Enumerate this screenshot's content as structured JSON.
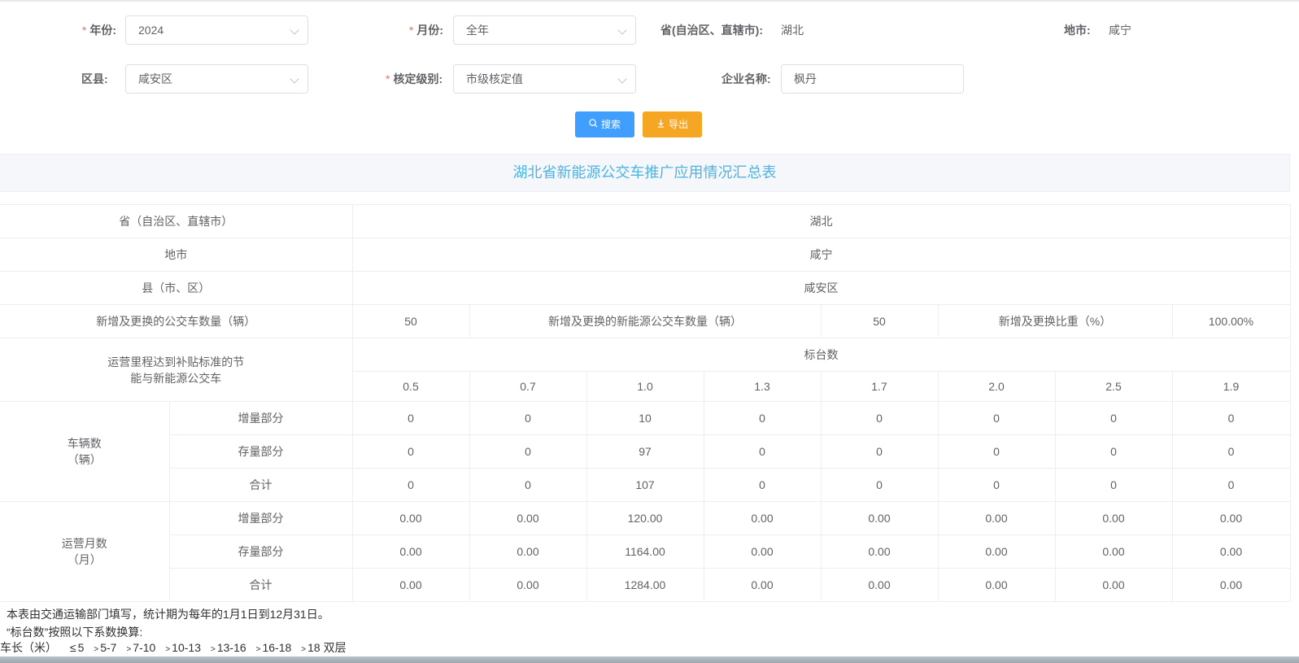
{
  "form": {
    "year": {
      "label": "年份:",
      "value": "2024"
    },
    "month": {
      "label": "月份:",
      "value": "全年"
    },
    "province": {
      "label": "省(自治区、直辖市):",
      "value": "湖北"
    },
    "city": {
      "label": "地市:",
      "value": "咸宁"
    },
    "district": {
      "label": "区县:",
      "value": "咸安区"
    },
    "level": {
      "label": "核定级别:",
      "value": "市级核定值"
    },
    "company": {
      "label": "企业名称:",
      "value": "枫丹"
    },
    "required_mark": "*"
  },
  "buttons": {
    "search": {
      "label": "搜索",
      "icon": "search-icon"
    },
    "export": {
      "label": "导出",
      "icon": "download-icon"
    }
  },
  "report": {
    "title": "湖北省新能源公交车推广应用情况汇总表",
    "province_label": "省（自治区、直辖市）",
    "province_value": "湖北",
    "city_label": "地市",
    "city_value": "咸宁",
    "county_label": "县（市、区）",
    "county_value": "咸安区",
    "new_bus_label": "新增及更换的公交车数量（辆）",
    "new_bus_value": "50",
    "new_ne_bus_label": "新增及更换的新能源公交车数量（辆）",
    "new_ne_bus_value": "50",
    "ratio_label": "新增及更换比重（%）",
    "ratio_value": "100.00%",
    "mileage_label_1": "运营里程达到补贴标准的节",
    "mileage_label_2": "能与新能源公交车",
    "standard_count_label": "标台数",
    "coefficients": [
      "0.5",
      "0.7",
      "1.0",
      "1.3",
      "1.7",
      "2.0",
      "2.5",
      "1.9"
    ],
    "vehicles": {
      "label_1": "车辆数",
      "label_2": "（辆）",
      "rows": [
        {
          "label": "增量部分",
          "values": [
            "0",
            "0",
            "10",
            "0",
            "0",
            "0",
            "0",
            "0"
          ]
        },
        {
          "label": "存量部分",
          "values": [
            "0",
            "0",
            "97",
            "0",
            "0",
            "0",
            "0",
            "0"
          ]
        },
        {
          "label": "合计",
          "values": [
            "0",
            "0",
            "107",
            "0",
            "0",
            "0",
            "0",
            "0"
          ]
        }
      ]
    },
    "months": {
      "label_1": "运营月数",
      "label_2": "（月）",
      "rows": [
        {
          "label": "增量部分",
          "values": [
            "0.00",
            "0.00",
            "120.00",
            "0.00",
            "0.00",
            "0.00",
            "0.00",
            "0.00"
          ]
        },
        {
          "label": "存量部分",
          "values": [
            "0.00",
            "0.00",
            "1164.00",
            "0.00",
            "0.00",
            "0.00",
            "0.00",
            "0.00"
          ]
        },
        {
          "label": "合计",
          "values": [
            "0.00",
            "0.00",
            "1284.00",
            "0.00",
            "0.00",
            "0.00",
            "0.00",
            "0.00"
          ]
        }
      ]
    }
  },
  "notes": {
    "line1": "本表由交通运输部门填写，统计期为每年的1月1日到12月31日。",
    "line2": "“标台数”按照以下系数换算:",
    "coeff_label": "车长（米）",
    "ranges": [
      {
        "sym": "≤",
        "text": "5"
      },
      {
        "sym": ">",
        "text": "5-7"
      },
      {
        "sym": ">",
        "text": "7-10"
      },
      {
        "sym": ">",
        "text": "10-13"
      },
      {
        "sym": ">",
        "text": "13-16"
      },
      {
        "sym": ">",
        "text": "16-18"
      },
      {
        "sym": ">",
        "text": "18 双层"
      }
    ]
  }
}
